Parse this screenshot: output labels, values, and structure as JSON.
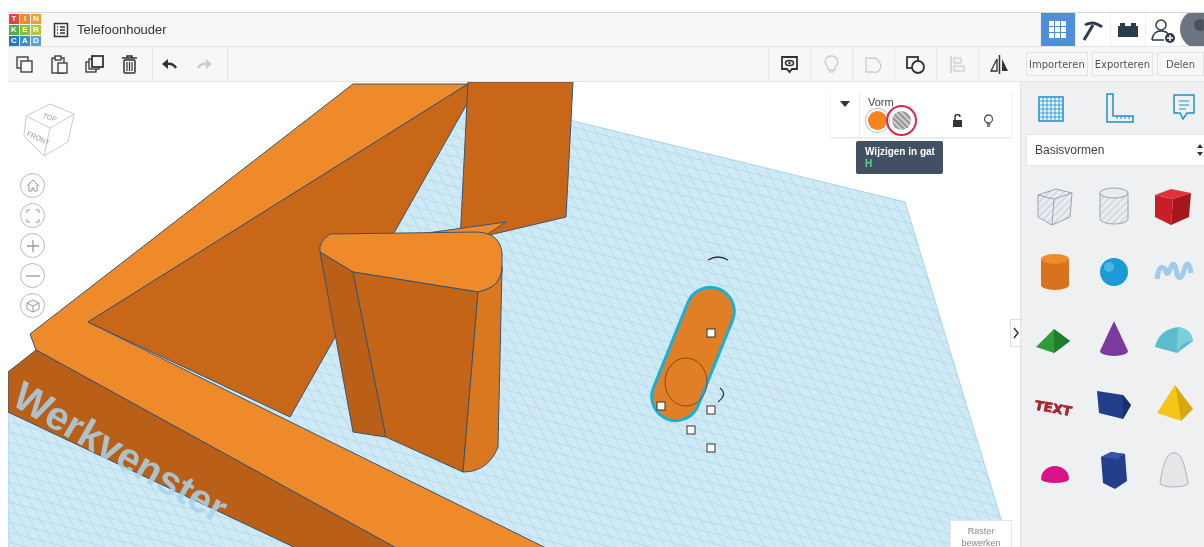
{
  "header": {
    "logo_letters": [
      "T",
      "I",
      "N",
      "K",
      "E",
      "R",
      "C",
      "A",
      "D"
    ],
    "project_title": "Telefoonhouder",
    "mode_tabs": [
      {
        "kind": "grid",
        "selected": true
      },
      {
        "kind": "pickaxe",
        "selected": false
      },
      {
        "kind": "brick",
        "selected": false
      },
      {
        "kind": "user-add",
        "selected": false
      }
    ]
  },
  "toolbar": {
    "edit_tools": [
      {
        "kind": "copy",
        "disabled": false
      },
      {
        "kind": "paste",
        "disabled": false
      },
      {
        "kind": "duplicate",
        "disabled": false
      },
      {
        "kind": "delete",
        "disabled": false
      }
    ],
    "history_tools": [
      {
        "kind": "undo",
        "disabled": false
      },
      {
        "kind": "redo",
        "disabled": true
      }
    ],
    "view_tools": [
      {
        "kind": "note",
        "disabled": false
      },
      {
        "kind": "bulb",
        "disabled": true
      },
      {
        "kind": "group",
        "disabled": true
      },
      {
        "kind": "ungroup",
        "disabled": false
      },
      {
        "kind": "align",
        "disabled": true
      },
      {
        "kind": "mirror",
        "disabled": false
      }
    ],
    "buttons": [
      "Importeren",
      "Exporteren",
      "Delen"
    ]
  },
  "viewport": {
    "viewcube": {
      "top": "TOP",
      "front": "FRONT"
    },
    "nav_buttons": [
      {
        "kind": "home"
      },
      {
        "kind": "fit"
      },
      {
        "kind": "zoom-in"
      },
      {
        "kind": "zoom-out"
      },
      {
        "kind": "perspective"
      }
    ],
    "workplane_label": "Werkvenster",
    "shape_inspector": {
      "title": "Vorm",
      "options": [
        {
          "kind": "solid",
          "color": "#f5841f",
          "selected": true
        },
        {
          "kind": "hole",
          "selected": false
        }
      ],
      "locked": false
    },
    "tooltip": {
      "text": "Wijzigen in gat",
      "shortcut": "H"
    },
    "edit_grid_button": "Raster bewerken"
  },
  "shapes_panel": {
    "views": [
      {
        "kind": "workplane"
      },
      {
        "kind": "ruler"
      },
      {
        "kind": "notes"
      }
    ],
    "category": "Basisvormen",
    "shapes": [
      {
        "kind": "box-hole"
      },
      {
        "kind": "cylinder-hole"
      },
      {
        "kind": "box"
      },
      {
        "kind": "cylinder"
      },
      {
        "kind": "sphere"
      },
      {
        "kind": "scribble"
      },
      {
        "kind": "roof"
      },
      {
        "kind": "cone"
      },
      {
        "kind": "round-roof"
      },
      {
        "kind": "text",
        "label": "TEXT"
      },
      {
        "kind": "polygon"
      },
      {
        "kind": "pyramid"
      },
      {
        "kind": "half-sphere"
      },
      {
        "kind": "hexagonal-prism"
      },
      {
        "kind": "paraboloid"
      }
    ]
  }
}
